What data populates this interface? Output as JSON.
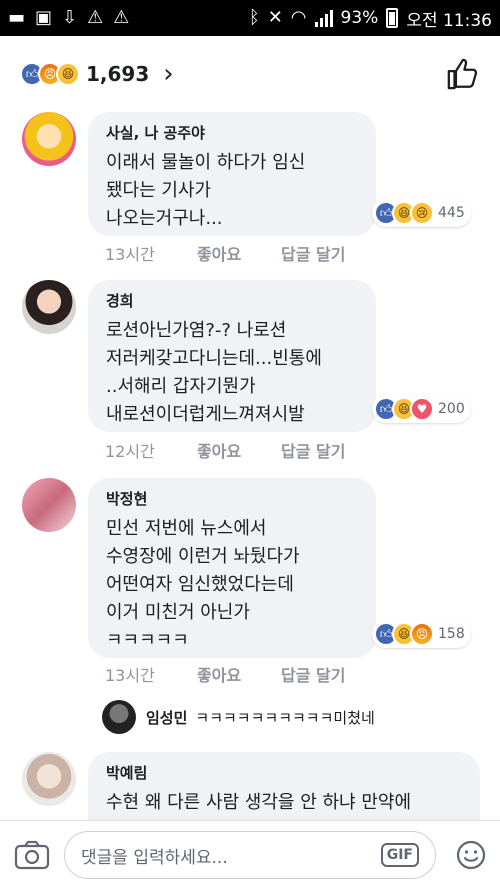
{
  "status_bar": {
    "battery": "93%",
    "time": "오전 11:36"
  },
  "header": {
    "reaction_count": "1,693"
  },
  "comments": [
    {
      "author": "사실, 나 공주야",
      "lines": [
        "이래서 물놀이 하다가 임신",
        "됐다는 기사가",
        "나오는거구나..."
      ],
      "reactions": [
        "like",
        "haha",
        "sad"
      ],
      "reaction_count": "445",
      "time": "13시간",
      "like_label": "좋아요",
      "reply_label": "답글 달기"
    },
    {
      "author": "경희",
      "lines": [
        "로션아닌가염?-? 나로션",
        "저러케갖고다니는데...빈통에",
        "..서해리 갑자기뭔가",
        "내로션이더럽게느껴져시발"
      ],
      "reactions": [
        "like",
        "haha",
        "love"
      ],
      "reaction_count": "200",
      "time": "12시간",
      "like_label": "좋아요",
      "reply_label": "답글 달기"
    },
    {
      "author": "박정현",
      "lines": [
        "민선 저번에 뉴스에서",
        "수영장에 이런거 놔뒀다가",
        "어떤여자 임신했었다는데",
        "이거 미친거 아닌가",
        "ㅋㅋㅋㅋㅋ"
      ],
      "reactions": [
        "like",
        "haha",
        "angry"
      ],
      "reaction_count": "158",
      "time": "13시간",
      "like_label": "좋아요",
      "reply_label": "답글 달기"
    },
    {
      "author": "박예림",
      "lines": [
        "수현 왜 다른 사람 생각을 안 하냐 만약에"
      ]
    }
  ],
  "reply": {
    "author": "임성민",
    "text": "ㅋㅋㅋㅋㅋㅋㅋㅋㅋㅋ미쳤네"
  },
  "composer": {
    "placeholder": "댓글을 입력하세요...",
    "gif_label": "GIF"
  }
}
